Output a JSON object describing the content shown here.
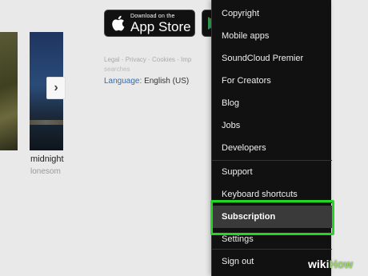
{
  "thumbnails": {
    "track_title": "midnight",
    "track_user": "lonesom"
  },
  "badges": {
    "app_store_small": "Download on the",
    "app_store_big": "App Store"
  },
  "footer": {
    "links": [
      "Legal",
      "Privacy",
      "Cookies",
      "Imp"
    ],
    "separator": " - ",
    "more_text": "searches",
    "language_label": "Language:",
    "language_value": "English (US)"
  },
  "menu": {
    "items": [
      {
        "label": "Copyright"
      },
      {
        "label": "Mobile apps"
      },
      {
        "label": "SoundCloud Premier"
      },
      {
        "label": "For Creators"
      },
      {
        "label": "Blog"
      },
      {
        "label": "Jobs"
      },
      {
        "label": "Developers"
      },
      {
        "label": "Support"
      },
      {
        "label": "Keyboard shortcuts"
      },
      {
        "label": "Subscription"
      },
      {
        "label": "Settings"
      },
      {
        "label": "Sign out"
      }
    ]
  },
  "watermark": {
    "wiki": "wiki",
    "how": "How"
  },
  "colors": {
    "highlight_border": "#26d426",
    "language_label": "#2a6eb8"
  }
}
